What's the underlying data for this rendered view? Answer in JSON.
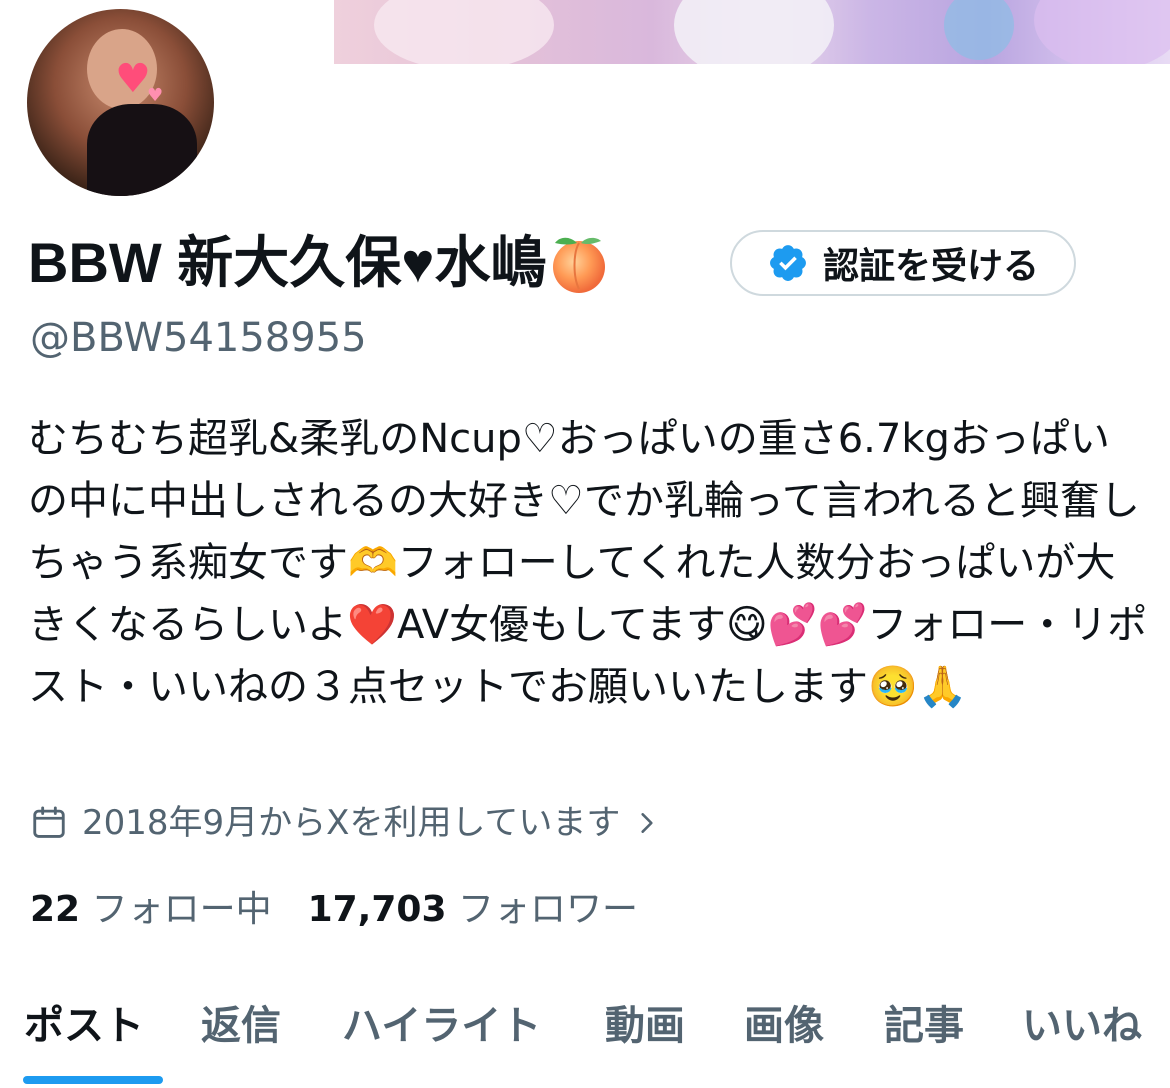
{
  "profile": {
    "display_name": "BBW 新大久保♥水嶋",
    "name_emoji": "peach-emoji",
    "handle": "@BBW54158955",
    "bio": "むちむち超乳&柔乳のNcup♡おっぱいの重さ6.7kgおっぱいの中に中出しされるの大好き♡でか乳輪って言われると興奮しちゃう系痴女です🫶フォローしてくれた人数分おっぱいが大きくなるらしいよ❤️AV女優もしてます😋💕💕フォロー・リポスト・いいねの３点セットでお願いいたします🥹🙏",
    "joined": "2018年9月からXを利用しています",
    "following_count": "22",
    "following_label": "フォロー中",
    "followers_count": "17,703",
    "followers_label": "フォロワー"
  },
  "actions": {
    "verify_label": "認証を受ける"
  },
  "tabs": [
    {
      "label": "ポスト",
      "active": true
    },
    {
      "label": "返信",
      "active": false
    },
    {
      "label": "ハイライト",
      "active": false
    },
    {
      "label": "動画",
      "active": false
    },
    {
      "label": "画像",
      "active": false
    },
    {
      "label": "記事",
      "active": false
    },
    {
      "label": "いいね",
      "active": false
    }
  ],
  "colors": {
    "accent": "#1d9bf0",
    "text_primary": "#0f1419",
    "text_secondary": "#536471",
    "border": "#cfd9de"
  }
}
